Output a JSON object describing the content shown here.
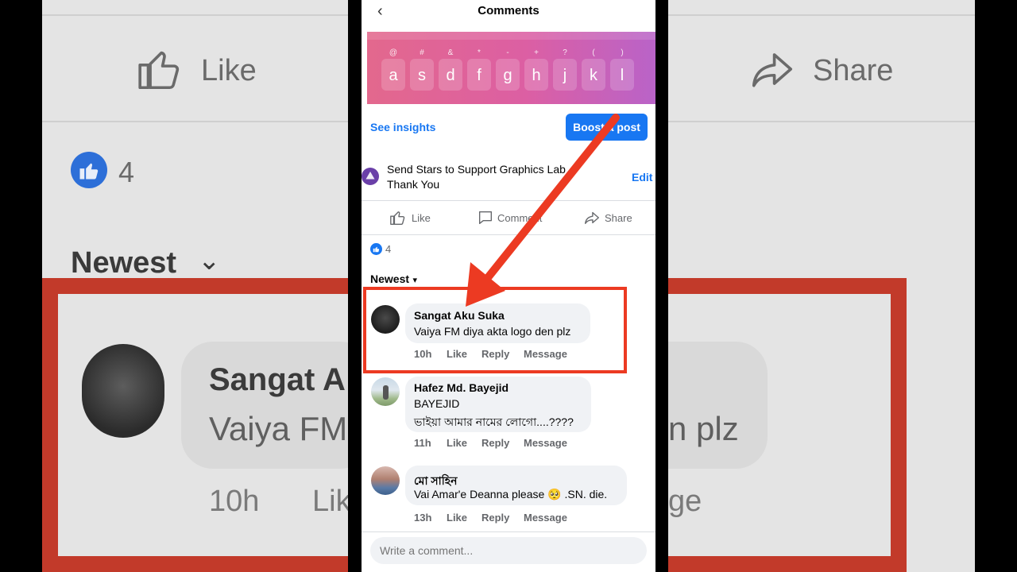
{
  "header": {
    "title": "Comments"
  },
  "keyboard": {
    "keys": [
      {
        "char": "a",
        "sym": "@"
      },
      {
        "char": "s",
        "sym": "#"
      },
      {
        "char": "d",
        "sym": "&"
      },
      {
        "char": "f",
        "sym": "*"
      },
      {
        "char": "g",
        "sym": "-"
      },
      {
        "char": "h",
        "sym": "+"
      },
      {
        "char": "j",
        "sym": "?"
      },
      {
        "char": "k",
        "sym": "("
      },
      {
        "char": "l",
        "sym": ")"
      }
    ]
  },
  "post": {
    "insights_label": "See insights",
    "boost_label": "Boost a post",
    "stars_line1": "Send Stars to Support Graphics Lab",
    "stars_line2": "Thank You",
    "edit_label": "Edit",
    "like_label": "Like",
    "comment_label": "Comment",
    "share_label": "Share",
    "reaction_count": "4",
    "sort_label": "Newest"
  },
  "comments": [
    {
      "name": "Sangat Aku Suka",
      "lines": [
        "Vaiya FM diya akta logo den plz"
      ],
      "time": "10h",
      "like": "Like",
      "reply": "Reply",
      "message": "Message"
    },
    {
      "name": "Hafez Md. Bayejid",
      "lines": [
        "BAYEJID",
        "ভাইয়া আমার নামের লোগো....????"
      ],
      "time": "11h",
      "like": "Like",
      "reply": "Reply",
      "message": "Message"
    },
    {
      "name": "মো সাহিন",
      "lines": [
        "Vai Amar'e Deanna please 🥺 .SN. die."
      ],
      "time": "13h",
      "like": "Like",
      "reply": "Reply",
      "message": "Message"
    }
  ],
  "composer": {
    "placeholder": "Write a comment..."
  },
  "background": {
    "like": "Like",
    "share": "Share",
    "count": "4",
    "sort": "Newest",
    "name_fragment": "Sangat A",
    "text_fragment": "Vaiya FM",
    "text_tail": "n plz",
    "time": "10h",
    "like_fragment": "Lik",
    "message_fragment": "ge"
  },
  "colors": {
    "accent": "#1877f2",
    "annotation_red": "#ec3a22",
    "keyboard_start": "#e3688d",
    "keyboard_end": "#b963c8"
  }
}
